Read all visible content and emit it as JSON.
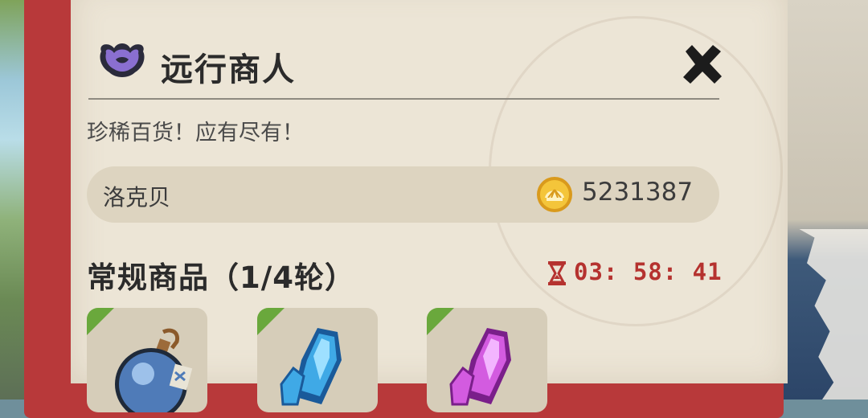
{
  "header": {
    "title": "远行商人",
    "subtitle": "珍稀百货！应有尽有！"
  },
  "player": {
    "name": "洛克贝",
    "coins": "5231387"
  },
  "section": {
    "title": "常规商品（1/4轮）",
    "timer": "03: 58: 41"
  },
  "goods": [
    {
      "icon": "potion-bottle-icon"
    },
    {
      "icon": "blue-crystal-icon"
    },
    {
      "icon": "purple-crystal-icon"
    }
  ],
  "colors": {
    "panel_border": "#b8393a",
    "panel_bg": "#ece5d6",
    "timer": "#b5322f",
    "badge": "#6aa83c"
  }
}
